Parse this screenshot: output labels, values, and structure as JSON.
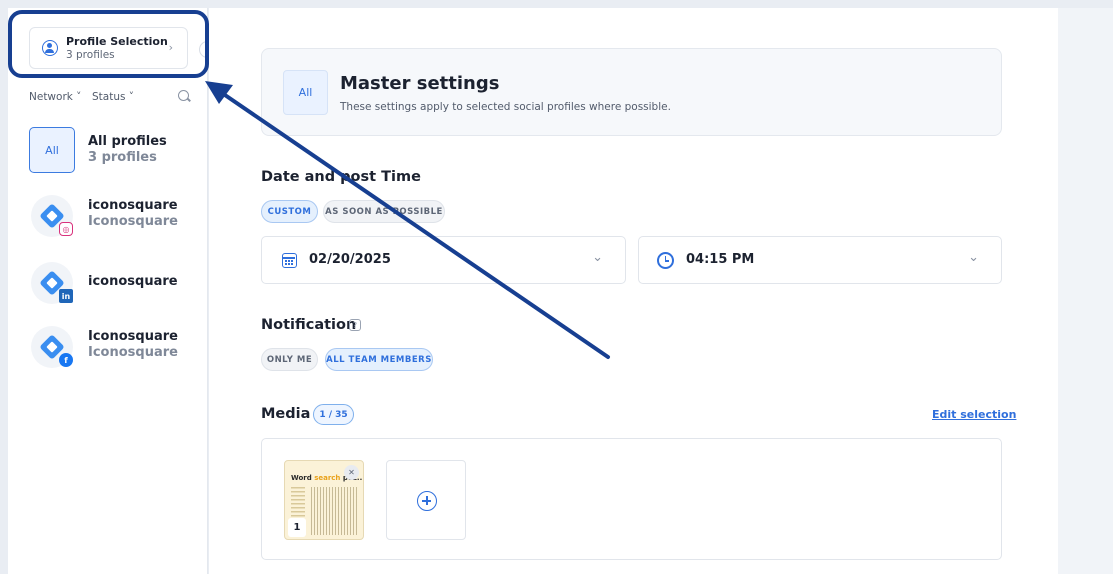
{
  "sidebar": {
    "profile_selection": {
      "title": "Profile Selection",
      "subtitle": "3 profiles",
      "chevron": "›"
    },
    "collapse_glyph": "‹",
    "filters": {
      "network": "Network ˅",
      "status": "Status ˅"
    },
    "profiles": [
      {
        "tile": "All",
        "name": "All profiles",
        "sub": "3 profiles",
        "network": null
      },
      {
        "name": "iconosquare",
        "sub": "Iconosquare",
        "network": "instagram",
        "badge": "◎"
      },
      {
        "name": "iconosquare",
        "sub": "",
        "network": "linkedin",
        "badge": "in"
      },
      {
        "name": "Iconosquare",
        "sub": "Iconosquare",
        "network": "facebook",
        "badge": "f"
      }
    ]
  },
  "main": {
    "master": {
      "tile": "All",
      "title": "Master settings",
      "subtitle": "These settings apply to selected social profiles where possible."
    },
    "date_time": {
      "title": "Date and post Time",
      "options": [
        "CUSTOM",
        "AS SOON AS POSSIBLE"
      ],
      "selected": "CUSTOM",
      "date": "02/20/2025",
      "time": "04:15 PM",
      "chevron": "⌄"
    },
    "notification": {
      "title": "Notification",
      "help": "?",
      "options": [
        "ONLY ME",
        "ALL TEAM MEMBERS"
      ],
      "selected": "ALL TEAM MEMBERS"
    },
    "media": {
      "title": "Media",
      "count": "1 / 35",
      "edit_label": "Edit selection",
      "thumb_title_a": "Word ",
      "thumb_title_hl": "search",
      "thumb_title_b": " puz..",
      "thumb_index": "1",
      "remove_glyph": "✕"
    }
  },
  "colors": {
    "accent": "#2f6fdc",
    "annotation": "#173f91"
  }
}
